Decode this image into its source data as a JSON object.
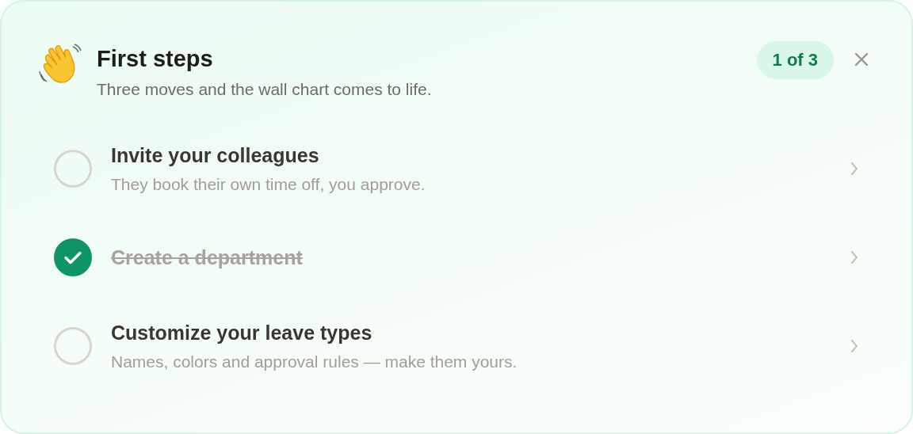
{
  "header": {
    "title": "First steps",
    "subtitle": "Three moves and the wall chart comes to life.",
    "progress_badge": "1 of 3"
  },
  "steps": [
    {
      "title": "Invite your colleagues",
      "description": "They book their own time off, you approve.",
      "checked": false
    },
    {
      "title": "Create a department",
      "checked": true
    },
    {
      "title": "Customize your leave types",
      "description": "Names, colors and approval rules — make them yours.",
      "checked": false
    }
  ]
}
